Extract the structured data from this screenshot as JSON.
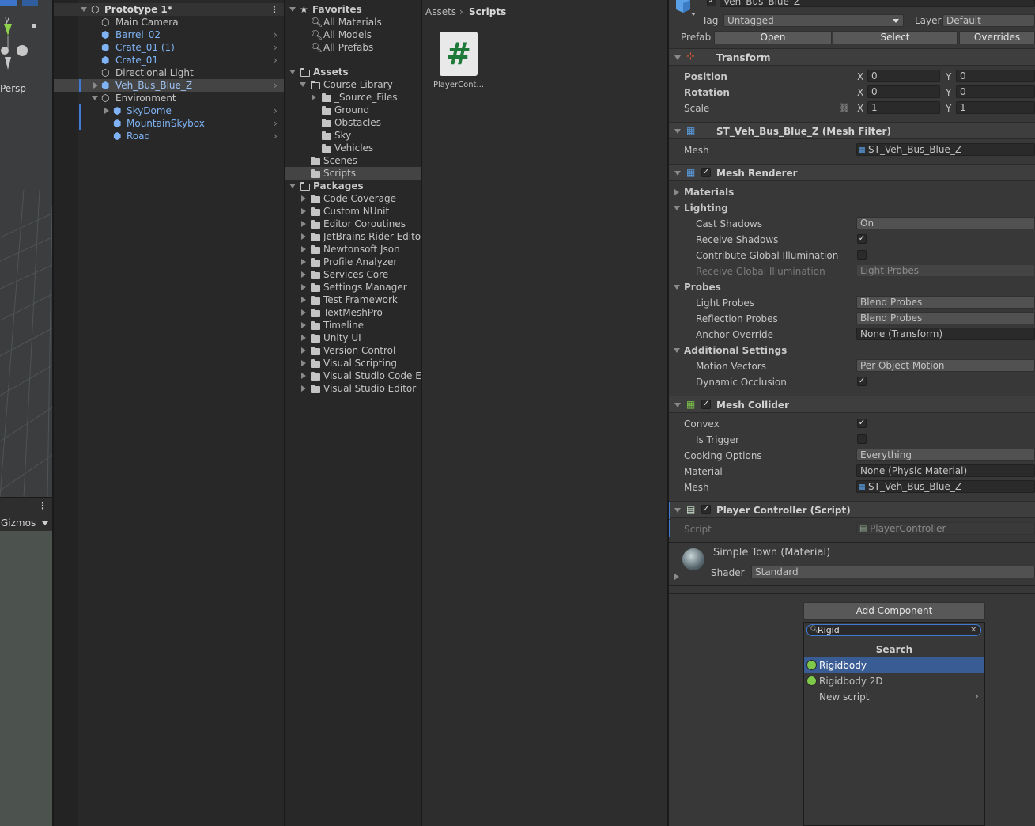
{
  "scene": {
    "y_label": "y",
    "persp_label": "Persp",
    "gizmos_label": "Gizmos"
  },
  "hierarchy": {
    "root": "Prototype 1*",
    "items": [
      {
        "label": "Main Camera",
        "prefab": false
      },
      {
        "label": "Barrel_02",
        "prefab": true
      },
      {
        "label": "Crate_01 (1)",
        "prefab": true
      },
      {
        "label": "Crate_01",
        "prefab": true
      },
      {
        "label": "Directional Light",
        "prefab": false
      },
      {
        "label": "Veh_Bus_Blue_Z",
        "prefab": true,
        "selected": true
      },
      {
        "label": "Environment",
        "prefab": false
      },
      {
        "label": "SkyDome",
        "prefab": true
      },
      {
        "label": "MountainSkybox",
        "prefab": true
      },
      {
        "label": "Road",
        "prefab": true
      }
    ]
  },
  "project": {
    "favorites": {
      "label": "Favorites",
      "items": [
        "All Materials",
        "All Models",
        "All Prefabs"
      ]
    },
    "assets": {
      "label": "Assets",
      "course_library": "Course Library",
      "course_items": [
        "_Source_Files",
        "Ground",
        "Obstacles",
        "Sky",
        "Vehicles"
      ],
      "scenes": "Scenes",
      "scripts": "Scripts"
    },
    "packages": {
      "label": "Packages",
      "items": [
        "Code Coverage",
        "Custom NUnit",
        "Editor Coroutines",
        "JetBrains Rider Editor",
        "Newtonsoft Json",
        "Profile Analyzer",
        "Services Core",
        "Settings Manager",
        "Test Framework",
        "TextMeshPro",
        "Timeline",
        "Unity UI",
        "Version Control",
        "Visual Scripting",
        "Visual Studio Code Ed",
        "Visual Studio Editor"
      ]
    }
  },
  "browser": {
    "breadcrumb": [
      "Assets",
      "Scripts"
    ],
    "asset_name": "PlayerCont...",
    "asset_glyph": "#"
  },
  "inspector": {
    "object_name": "Veh_Bus_Blue_Z",
    "tag_label": "Tag",
    "tag_value": "Untagged",
    "layer_label": "Layer",
    "layer_value": "Default",
    "prefab_label": "Prefab",
    "prefab_open": "Open",
    "prefab_select": "Select",
    "prefab_overrides": "Overrides",
    "transform": {
      "title": "Transform",
      "position_label": "Position",
      "rotation_label": "Rotation",
      "scale_label": "Scale",
      "x_label": "X",
      "y_label": "Y",
      "position": [
        "0",
        "0"
      ],
      "rotation": [
        "0",
        "0"
      ],
      "scale": [
        "1",
        "1"
      ]
    },
    "mesh_filter": {
      "title": "ST_Veh_Bus_Blue_Z (Mesh Filter)",
      "mesh_label": "Mesh",
      "mesh_value": "ST_Veh_Bus_Blue_Z"
    },
    "mesh_renderer": {
      "title": "Mesh Renderer",
      "materials": "Materials",
      "lighting": "Lighting",
      "cast_shadows": "Cast Shadows",
      "cast_shadows_value": "On",
      "receive_shadows": "Receive Shadows",
      "contribute_gi": "Contribute Global Illumination",
      "receive_gi": "Receive Global Illumination",
      "receive_gi_value": "Light Probes",
      "probes": "Probes",
      "light_probes": "Light Probes",
      "light_probes_value": "Blend Probes",
      "reflection_probes": "Reflection Probes",
      "reflection_probes_value": "Blend Probes",
      "anchor_override": "Anchor Override",
      "anchor_override_value": "None (Transform)",
      "additional": "Additional Settings",
      "motion_vectors": "Motion Vectors",
      "motion_vectors_value": "Per Object Motion",
      "dynamic_occlusion": "Dynamic Occlusion"
    },
    "mesh_collider": {
      "title": "Mesh Collider",
      "convex": "Convex",
      "is_trigger": "Is Trigger",
      "cooking_options": "Cooking Options",
      "cooking_value": "Everything",
      "material": "Material",
      "material_value": "None (Physic Material)",
      "mesh": "Mesh",
      "mesh_value": "ST_Veh_Bus_Blue_Z"
    },
    "player_controller": {
      "title": "Player Controller (Script)",
      "script_label": "Script",
      "script_value": "PlayerController"
    },
    "material": {
      "name": "Simple Town (Material)",
      "shader_label": "Shader",
      "shader_value": "Standard"
    }
  },
  "add_component": {
    "button": "Add Component",
    "search_value": "Rigid",
    "section": "Search",
    "results": [
      "Rigidbody",
      "Rigidbody 2D",
      "New script"
    ]
  },
  "colors": {
    "accent": "#3a5c94",
    "prefab_text": "#7fb3f5",
    "rigidbody_icon": "#7ec84a"
  }
}
